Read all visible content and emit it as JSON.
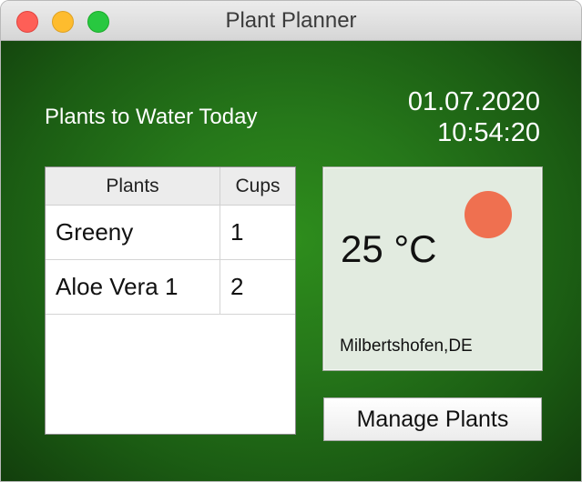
{
  "window": {
    "title": "Plant Planner"
  },
  "header": {
    "heading": "Plants to Water Today",
    "date": "01.07.2020",
    "time": "10:54:20"
  },
  "table": {
    "columns": [
      "Plants",
      "Cups"
    ],
    "rows": [
      {
        "plant": "Greeny",
        "cups": "1"
      },
      {
        "plant": "Aloe Vera 1",
        "cups": "2"
      }
    ]
  },
  "weather": {
    "temperature": "25 °C",
    "location": "Milbertshofen,DE",
    "icon": "sun-icon",
    "sun_color": "#ef7050"
  },
  "actions": {
    "manage_label": "Manage Plants"
  },
  "colors": {
    "background_green": "#26781a",
    "weather_panel": "#e2ebe0"
  }
}
